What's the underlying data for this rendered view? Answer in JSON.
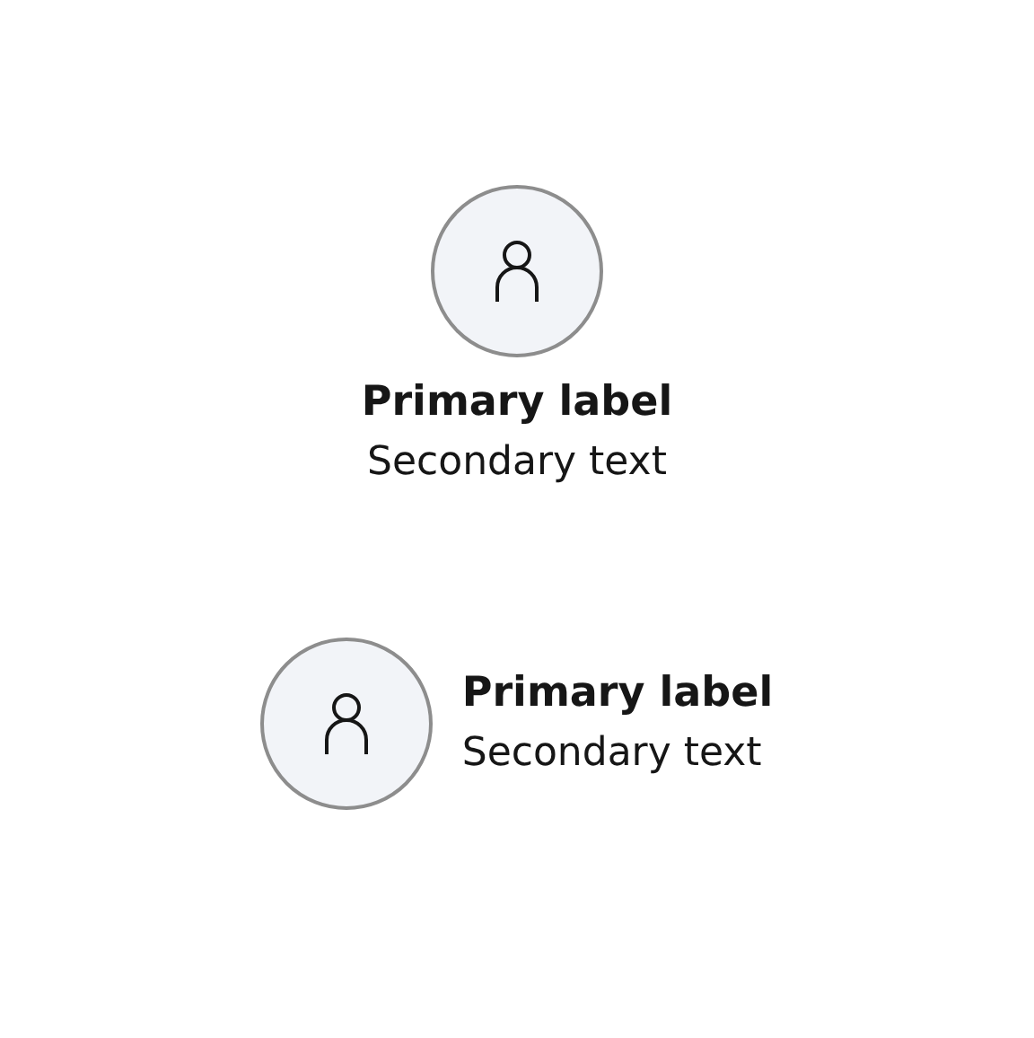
{
  "cards": [
    {
      "kind": "vertical",
      "primary": "Primary label",
      "secondary": "Secondary text"
    },
    {
      "kind": "horizontal",
      "primary": "Primary label",
      "secondary": "Secondary text"
    }
  ]
}
